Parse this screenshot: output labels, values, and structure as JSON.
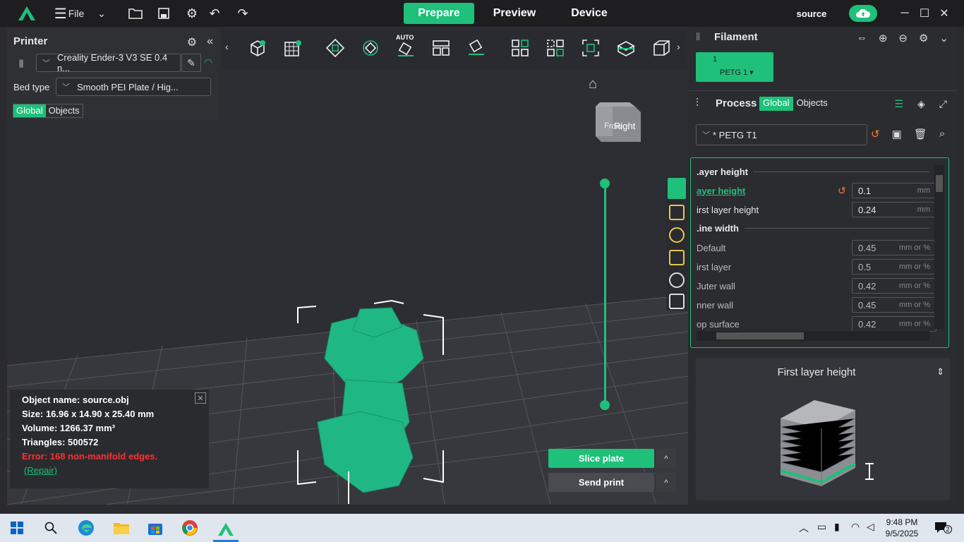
{
  "titlebar": {
    "file_label": "File",
    "tabs": [
      "Prepare",
      "Preview",
      "Device"
    ],
    "user": "source"
  },
  "printer_panel": {
    "title": "Printer",
    "printer_preset": "Creality Ender-3 V3 SE 0.4 n...",
    "bed_type_label": "Bed type",
    "bed_type_value": "Smooth PEI Plate / Hig...",
    "seg_global": "Global",
    "seg_objects": "Objects"
  },
  "toolbar": {
    "auto_label": "AUTO"
  },
  "view": {
    "cube_front": "Front",
    "cube_right": "Right"
  },
  "object_info": {
    "name": "Object name: source.obj",
    "size": "Size: 16.96 x 14.90 x 25.40 mm",
    "volume": "Volume: 1266.37 mm³",
    "triangles": "Triangles: 500572",
    "error": "Error: 168 non-manifold edges.",
    "repair": "(Repair)"
  },
  "actions": {
    "slice": "Slice plate",
    "send": "Send print",
    "caret": "^"
  },
  "filament": {
    "title": "Filament",
    "chip_number": "1",
    "chip_label": "PETG 1 ▾"
  },
  "process": {
    "title": "Process",
    "seg_global": "Global",
    "seg_objects": "Objects",
    "preset": "* PETG T1"
  },
  "params": {
    "sections": [
      {
        "label": ".ayer height"
      },
      {
        "label": ".ine width"
      }
    ],
    "rows": [
      {
        "label": "ayer height",
        "value": "0.1",
        "unit": "mm"
      },
      {
        "label": "irst layer height",
        "value": "0.24",
        "unit": "mm"
      },
      {
        "label": "Default",
        "value": "0.45",
        "unit": "mm or %"
      },
      {
        "label": "irst layer",
        "value": "0.5",
        "unit": "mm or %"
      },
      {
        "label": "Juter wall",
        "value": "0.42",
        "unit": "mm or %"
      },
      {
        "label": "nner wall",
        "value": "0.45",
        "unit": "mm or %"
      },
      {
        "label": "op surface",
        "value": "0.42",
        "unit": "mm or %"
      }
    ]
  },
  "help": {
    "title": "First layer height"
  },
  "taskbar": {
    "time": "9:48 PM",
    "date": "9/5/2025",
    "notif_count": "2"
  },
  "colors": {
    "accent": "#1ec07a",
    "warning": "#ff7a30",
    "error": "#ff3030"
  }
}
